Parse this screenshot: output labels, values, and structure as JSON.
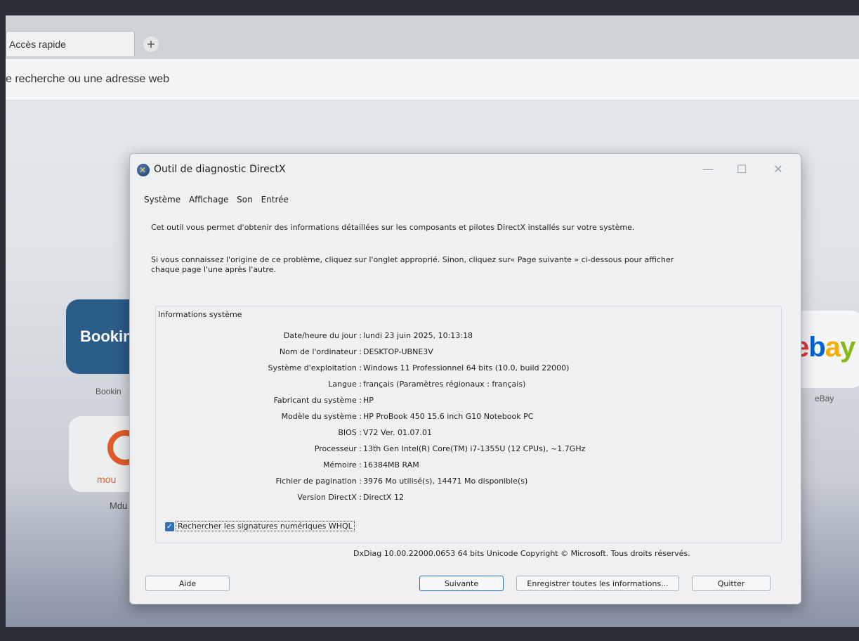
{
  "browser": {
    "tab_label": "Accès rapide",
    "new_tab_symbol": "+",
    "address_text": "e recherche ou une adresse web"
  },
  "tiles": {
    "booking_text": "Bookin",
    "booking_label": "Bookin",
    "moodle_text": "mou",
    "moodle_label": "Mdu",
    "ebay_label": "eBay",
    "ebay_letters": [
      "e",
      "b",
      "a",
      "y"
    ],
    "ebay_colors": [
      "#e53238",
      "#0064d2",
      "#f5af02",
      "#86b817"
    ]
  },
  "dialog": {
    "title": "Outil de diagnostic DirectX",
    "window_buttons": [
      "—",
      "☐",
      "✕"
    ],
    "tabs": [
      "Système",
      "Affichage",
      "Son",
      "Entrée"
    ],
    "intro": "Cet outil vous permet d'obtenir des informations détaillées sur les composants et pilotes DirectX installés sur votre système.",
    "instructions": "Si vous connaissez l'origine de ce problème, cliquez sur l'onglet approprié. Sinon, cliquez sur« Page suivante » ci-dessous pour afficher chaque page l'une après l'autre.",
    "group_title": "Informations système",
    "info": [
      {
        "key": "Date/heure du jour :",
        "value": "lundi 23 juin 2025, 10:13:18"
      },
      {
        "key": "Nom de l'ordinateur :",
        "value": "DESKTOP-UBNE3V"
      },
      {
        "key": "Système d'exploitation :",
        "value": "Windows 11 Professionnel 64 bits (10.0, build 22000)"
      },
      {
        "key": "Langue :",
        "value": "français (Paramètres régionaux : français)"
      },
      {
        "key": "Fabricant du système :",
        "value": "HP"
      },
      {
        "key": "Modèle du système :",
        "value": "HP ProBook 450 15.6 inch G10 Notebook PC"
      },
      {
        "key": "BIOS :",
        "value": "V72 Ver. 01.07.01"
      },
      {
        "key": "Processeur :",
        "value": "13th Gen Intel(R) Core(TM) i7-1355U (12 CPUs), ~1.7GHz"
      },
      {
        "key": "Mémoire :",
        "value": "16384MB RAM"
      },
      {
        "key": "Fichier de pagination :",
        "value": "3976 Mo utilisé(s), 14471 Mo disponible(s)"
      },
      {
        "key": "Version DirectX :",
        "value": "DirectX 12"
      }
    ],
    "whql_checked": true,
    "whql_label": "Rechercher les signatures numériques WHQL",
    "copyright": "DxDiag 10.00.22000.0653 64 bits Unicode Copyright © Microsoft. Tous droits réservés.",
    "buttons": {
      "help": "Aide",
      "next": "Suivante",
      "save_all": "Enregistrer toutes les informations...",
      "quit": "Quitter"
    }
  }
}
